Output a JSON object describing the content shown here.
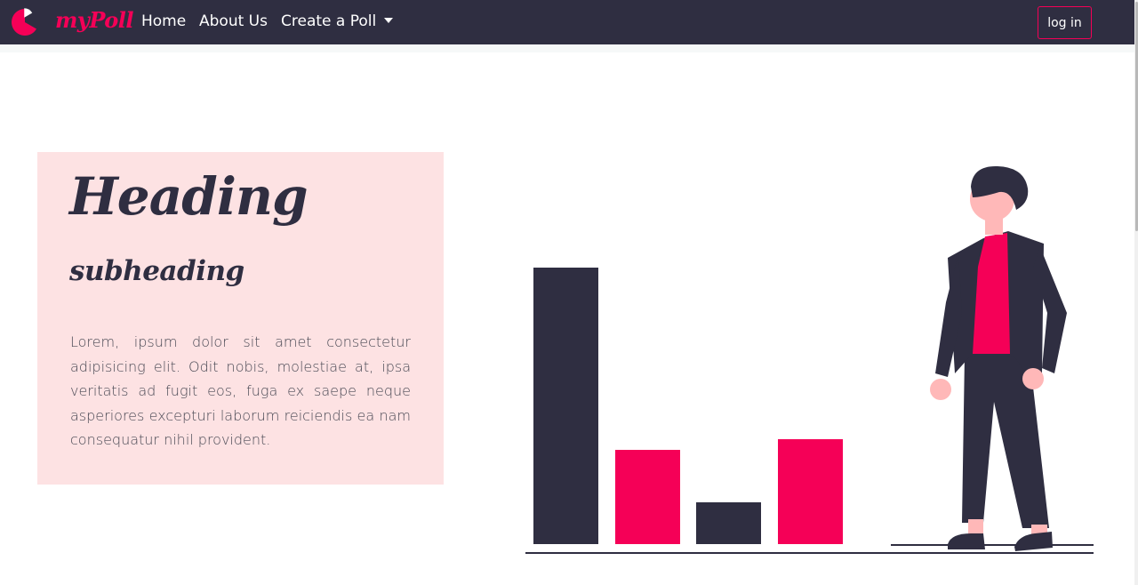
{
  "navbar": {
    "brand": "myPoll",
    "links": [
      {
        "label": "Home"
      },
      {
        "label": "About Us"
      },
      {
        "label": "Create a Poll"
      }
    ],
    "login_label": "log in"
  },
  "hero": {
    "heading": "Heading",
    "subheading": "subheading",
    "body": "Lorem, ipsum dolor sit amet consectetur adipisicing elit. Odit nobis, molestiae at, ipsa veritatis ad fugit eos, fuga ex saepe neque asperiores excepturi laborum reiciendis ea nam consequatur nihil provident."
  },
  "illustration": {
    "bar_levels": [
      1.0,
      0.34,
      0.15,
      0.38
    ],
    "bar_colors": [
      "#2f2e41",
      "#f50057",
      "#2f2e41",
      "#f50057"
    ]
  },
  "colors": {
    "navbar": "#2f2e41",
    "accent": "#f50057",
    "card": "#fde2e3",
    "dark": "#2f2e41",
    "skin": "#ffb8b8"
  },
  "icons": {
    "brand": "pie-chart-icon",
    "dropdown": "caret-down-icon"
  }
}
